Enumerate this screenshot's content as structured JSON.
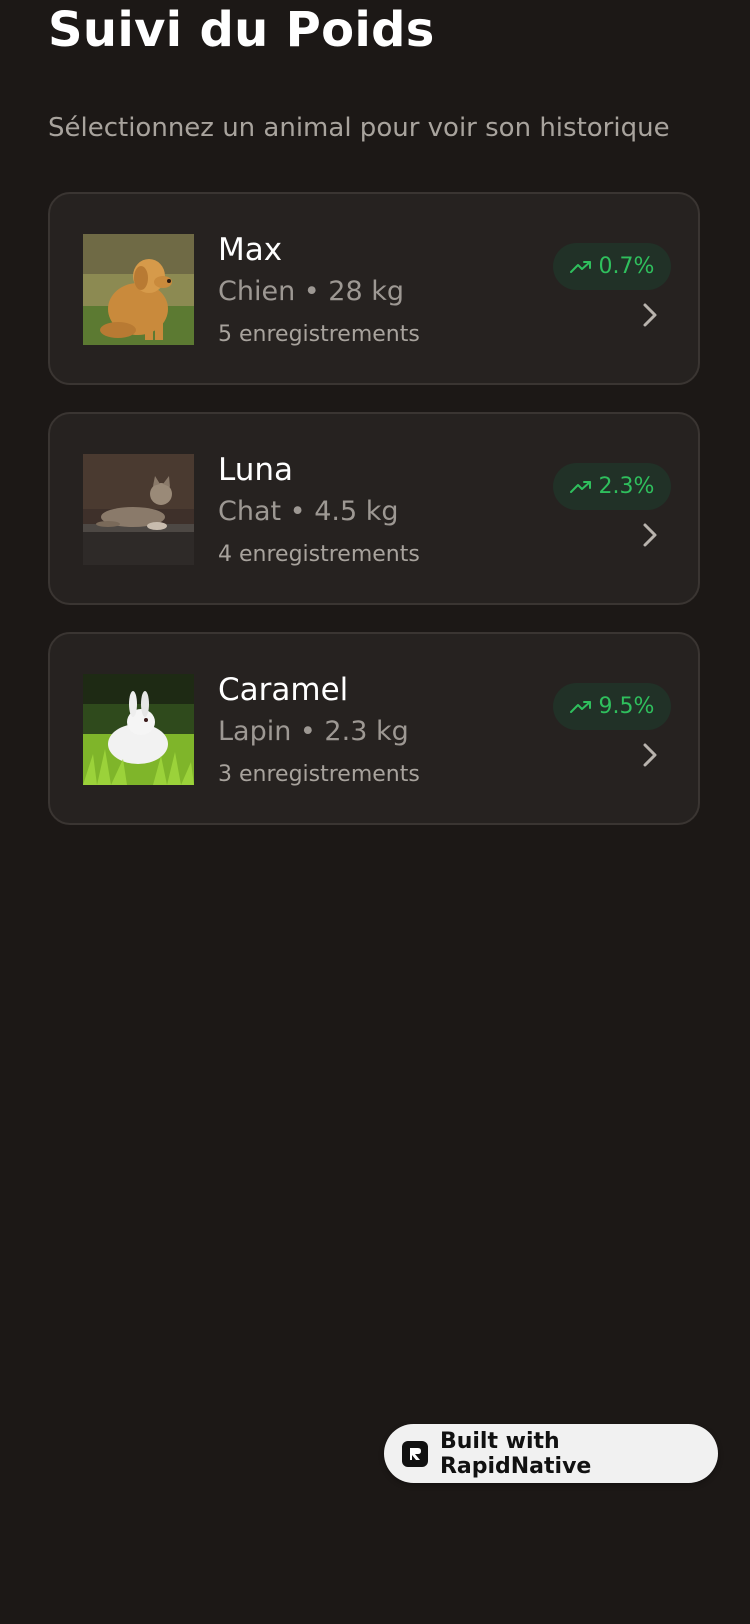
{
  "header": {
    "title": "Suivi du Poids",
    "subtitle": "Sélectionnez un animal pour voir son historique"
  },
  "pets": [
    {
      "name": "Max",
      "meta": "Chien • 28 kg",
      "records": "5 enregistrements",
      "trend": "0.7%",
      "photo": "golden-retriever-photo"
    },
    {
      "name": "Luna",
      "meta": "Chat • 4.5 kg",
      "records": "4 enregistrements",
      "trend": "2.3%",
      "photo": "tabby-cat-photo"
    },
    {
      "name": "Caramel",
      "meta": "Lapin • 2.3 kg",
      "records": "3 enregistrements",
      "trend": "9.5%",
      "photo": "white-rabbit-photo"
    }
  ],
  "footer": {
    "badge_label": "Built with RapidNative"
  },
  "colors": {
    "background": "#1c1816",
    "card": "#262220",
    "trend_up": "#2fbf5d",
    "trend_bg": "#213127"
  },
  "icons": {
    "trend": "trending-up-icon",
    "chevron": "chevron-right-icon",
    "brand": "rapidnative-logo-icon"
  }
}
